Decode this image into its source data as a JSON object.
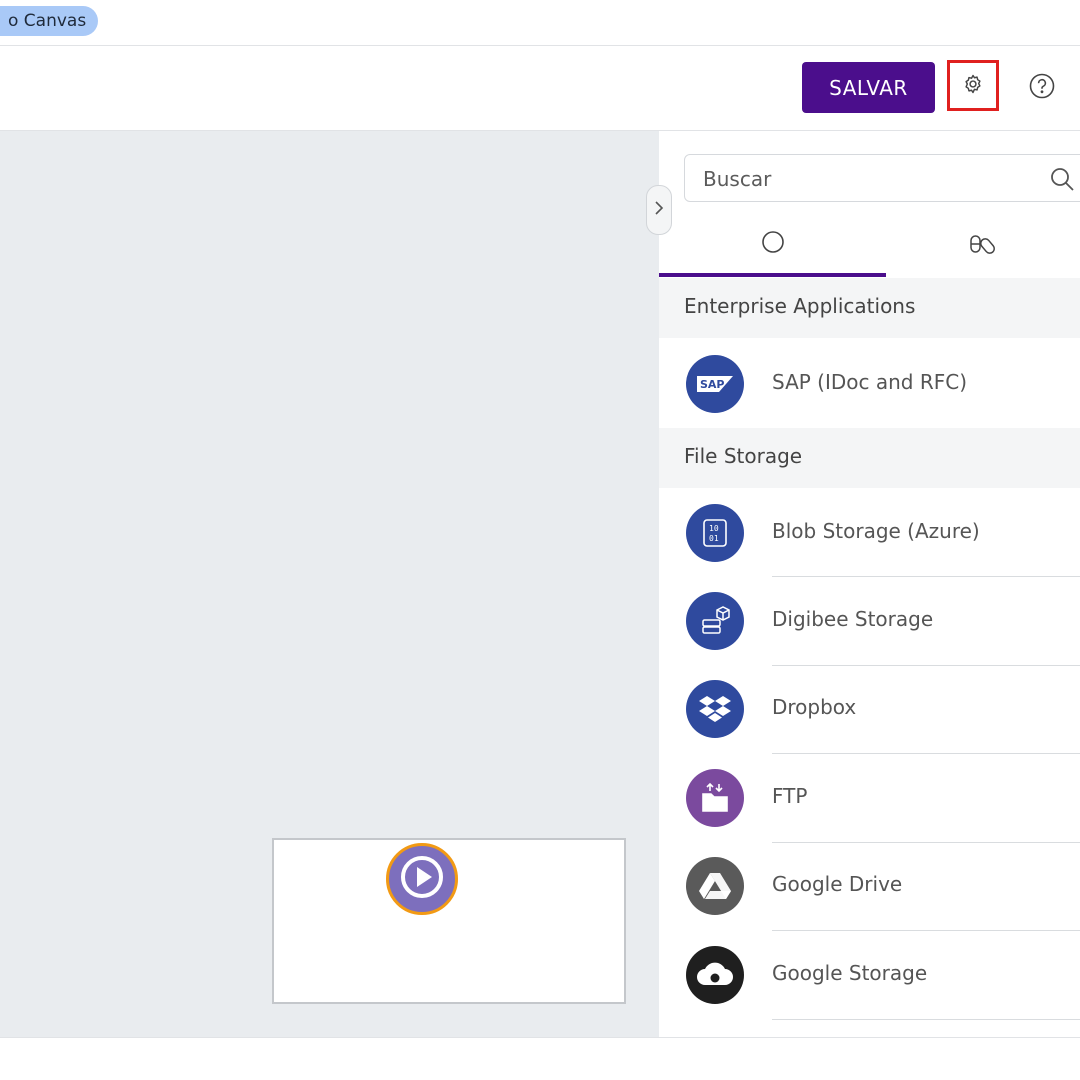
{
  "header": {
    "canvas_tab_label": "o Canvas"
  },
  "toolbar": {
    "save_label": "SALVAR",
    "settings_icon": "gear-icon",
    "help_icon": "help-circle-icon",
    "accent": "#4b0e8c",
    "highlight": "#e0201f"
  },
  "panel": {
    "search": {
      "placeholder": "Buscar"
    },
    "tabs": [
      {
        "icon": "circle-icon",
        "active": true
      },
      {
        "icon": "capsules-icon",
        "active": false
      }
    ],
    "sections": [
      {
        "title": "Enterprise Applications",
        "items": [
          {
            "label": "SAP (IDoc and RFC)",
            "icon": "sap-icon",
            "color": "#2f4a9e"
          }
        ]
      },
      {
        "title": "File Storage",
        "items": [
          {
            "label": "Blob Storage (Azure)",
            "icon": "binary-file-icon",
            "color": "#2f4a9e"
          },
          {
            "label": "Digibee Storage",
            "icon": "storage-server-icon",
            "color": "#2f4a9e"
          },
          {
            "label": "Dropbox",
            "icon": "dropbox-icon",
            "color": "#2f4a9e"
          },
          {
            "label": "FTP",
            "icon": "folder-transfer-icon",
            "color": "#7b4a9e"
          },
          {
            "label": "Google Drive",
            "icon": "google-drive-icon",
            "color": "#5a5a5a"
          },
          {
            "label": "Google Storage",
            "icon": "cloud-icon",
            "color": "#1f1f1f"
          }
        ]
      }
    ]
  },
  "canvas": {
    "minimap_node_icon": "play-icon",
    "node_color": "#7d6fbd",
    "node_border": "#f29a14"
  }
}
